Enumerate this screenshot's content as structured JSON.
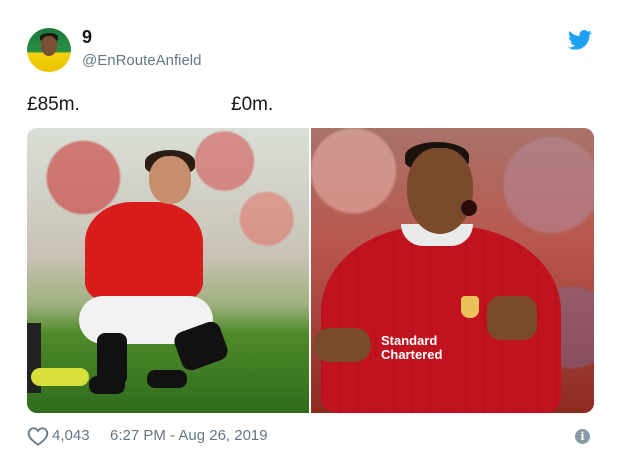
{
  "author": {
    "display_name": "9",
    "handle": "@EnRouteAnfield"
  },
  "tweet": {
    "text_left": "£85m.",
    "text_right": "£0m."
  },
  "media": {
    "photos": [
      {
        "sponsor_text": ""
      },
      {
        "sponsor_line1": "Standard",
        "sponsor_line2": "Chartered"
      }
    ]
  },
  "footer": {
    "likes": "4,043",
    "timestamp": "6:27 PM - Aug 26, 2019"
  },
  "icons": {
    "brand": "twitter-bird-icon",
    "like": "heart-icon",
    "info": "info-icon"
  },
  "colors": {
    "twitter_blue": "#1da1f2",
    "secondary_text": "#657786"
  }
}
